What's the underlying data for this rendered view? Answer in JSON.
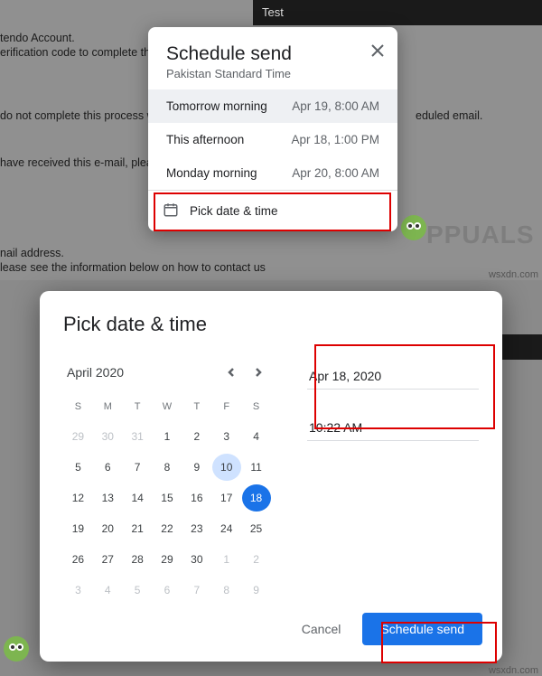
{
  "topBar": {
    "label": "Test"
  },
  "bg": {
    "l1": "tendo Account.",
    "l2": "erification code to complete the",
    "l3": "do not complete this process w",
    "l4": "have received this e-mail, pleas",
    "l5": "nail address.",
    "l6": "lease see the information below on how to contact us",
    "r1": "eduled email."
  },
  "schedule": {
    "title": "Schedule send",
    "tz": "Pakistan Standard Time",
    "options": [
      {
        "label": "Tomorrow morning",
        "time": "Apr 19, 8:00 AM",
        "selected": true
      },
      {
        "label": "This afternoon",
        "time": "Apr 18, 1:00 PM",
        "selected": false
      },
      {
        "label": "Monday morning",
        "time": "Apr 20, 8:00 AM",
        "selected": false
      }
    ],
    "pick": "Pick date & time"
  },
  "datepick": {
    "title": "Pick date & time",
    "month": "April 2020",
    "dow": [
      "S",
      "M",
      "T",
      "W",
      "T",
      "F",
      "S"
    ],
    "grid": [
      [
        29,
        30,
        31,
        1,
        2,
        3,
        4
      ],
      [
        5,
        6,
        7,
        8,
        9,
        10,
        11
      ],
      [
        12,
        13,
        14,
        15,
        16,
        17,
        18
      ],
      [
        19,
        20,
        21,
        22,
        23,
        24,
        25
      ],
      [
        26,
        27,
        28,
        29,
        30,
        1,
        2
      ],
      [
        3,
        4,
        5,
        6,
        7,
        8,
        9
      ]
    ],
    "offPrev": 3,
    "offNextStart": 31,
    "hoverDay": 10,
    "selDay": 18,
    "dateValue": "Apr 18, 2020",
    "timeValue": "10:22 AM",
    "cancel": "Cancel",
    "send": "Schedule send"
  },
  "watermark": {
    "text": "PPUALS",
    "host": "wsxdn.com"
  }
}
